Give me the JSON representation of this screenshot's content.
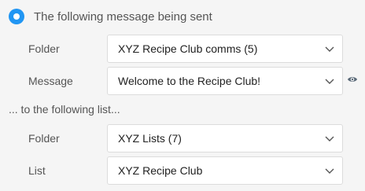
{
  "option": {
    "label": "The following message being sent",
    "selected": true
  },
  "message_section": {
    "folder_label": "Folder",
    "folder_value": "XYZ Recipe Club comms (5)",
    "message_label": "Message",
    "message_value": "Welcome to the Recipe Club!"
  },
  "list_section": {
    "heading": "... to the following list...",
    "folder_label": "Folder",
    "folder_value": "XYZ Lists (7)",
    "list_label": "List",
    "list_value": "XYZ Recipe Club"
  },
  "icons": {
    "dropdown": "chevron-down-icon",
    "preview": "eye-icon"
  },
  "colors": {
    "accent": "#2196f3",
    "background": "#f5f5f5"
  }
}
